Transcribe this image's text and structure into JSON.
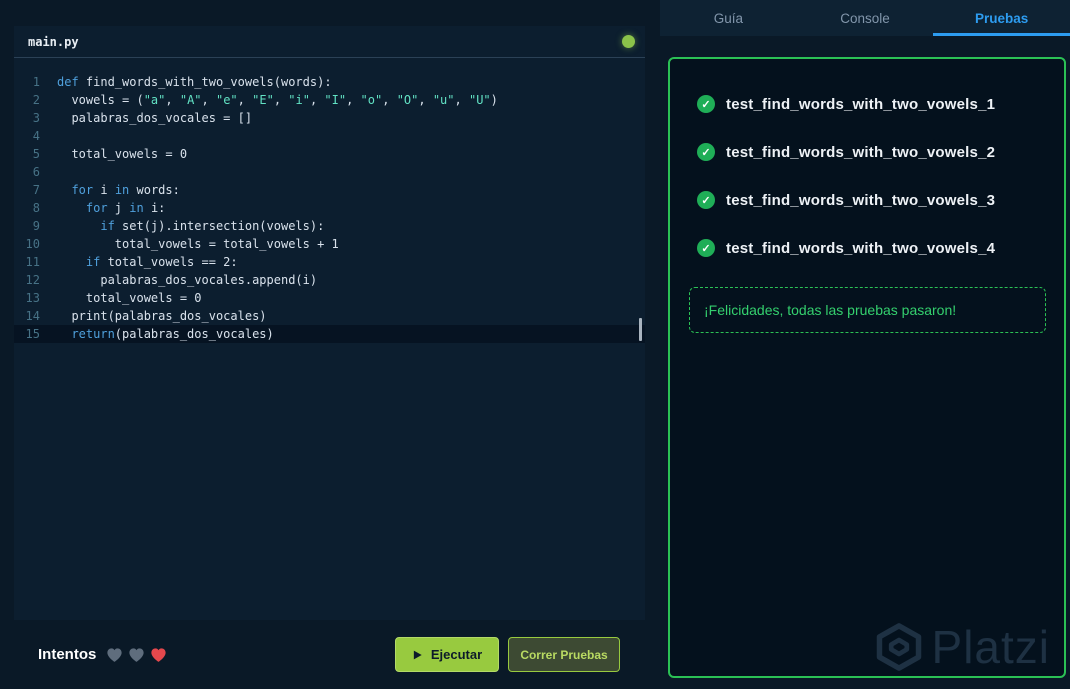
{
  "editor": {
    "filename": "main.py",
    "active_line": 15,
    "lines": [
      {
        "n": 1,
        "tokens": [
          {
            "c": "k",
            "t": "def"
          },
          {
            "c": "d",
            "t": " find_words_with_two_vowels(words):"
          }
        ]
      },
      {
        "n": 2,
        "tokens": [
          {
            "c": "d",
            "t": "  vowels = ("
          },
          {
            "c": "s",
            "t": "\"a\""
          },
          {
            "c": "d",
            "t": ", "
          },
          {
            "c": "s",
            "t": "\"A\""
          },
          {
            "c": "d",
            "t": ", "
          },
          {
            "c": "s",
            "t": "\"e\""
          },
          {
            "c": "d",
            "t": ", "
          },
          {
            "c": "s",
            "t": "\"E\""
          },
          {
            "c": "d",
            "t": ", "
          },
          {
            "c": "s",
            "t": "\"i\""
          },
          {
            "c": "d",
            "t": ", "
          },
          {
            "c": "s",
            "t": "\"I\""
          },
          {
            "c": "d",
            "t": ", "
          },
          {
            "c": "s",
            "t": "\"o\""
          },
          {
            "c": "d",
            "t": ", "
          },
          {
            "c": "s",
            "t": "\"O\""
          },
          {
            "c": "d",
            "t": ", "
          },
          {
            "c": "s",
            "t": "\"u\""
          },
          {
            "c": "d",
            "t": ", "
          },
          {
            "c": "s",
            "t": "\"U\""
          },
          {
            "c": "d",
            "t": ")"
          }
        ]
      },
      {
        "n": 3,
        "tokens": [
          {
            "c": "d",
            "t": "  palabras_dos_vocales = []"
          }
        ]
      },
      {
        "n": 4,
        "tokens": []
      },
      {
        "n": 5,
        "tokens": [
          {
            "c": "d",
            "t": "  total_vowels = 0"
          }
        ]
      },
      {
        "n": 6,
        "tokens": []
      },
      {
        "n": 7,
        "tokens": [
          {
            "c": "k",
            "t": "  for"
          },
          {
            "c": "d",
            "t": " i "
          },
          {
            "c": "k",
            "t": "in"
          },
          {
            "c": "d",
            "t": " words:"
          }
        ]
      },
      {
        "n": 8,
        "tokens": [
          {
            "c": "k",
            "t": "    for"
          },
          {
            "c": "d",
            "t": " j "
          },
          {
            "c": "k",
            "t": "in"
          },
          {
            "c": "d",
            "t": " i:"
          }
        ]
      },
      {
        "n": 9,
        "tokens": [
          {
            "c": "k",
            "t": "      if"
          },
          {
            "c": "d",
            "t": " set(j).intersection(vowels):"
          }
        ]
      },
      {
        "n": 10,
        "tokens": [
          {
            "c": "d",
            "t": "        total_vowels = total_vowels + 1"
          }
        ]
      },
      {
        "n": 11,
        "tokens": [
          {
            "c": "k",
            "t": "    if"
          },
          {
            "c": "d",
            "t": " total_vowels == 2:"
          }
        ]
      },
      {
        "n": 12,
        "tokens": [
          {
            "c": "d",
            "t": "      palabras_dos_vocales.append(i)"
          }
        ]
      },
      {
        "n": 13,
        "tokens": [
          {
            "c": "d",
            "t": "    total_vowels = 0"
          }
        ]
      },
      {
        "n": 14,
        "tokens": [
          {
            "c": "d",
            "t": "  print(palabras_dos_vocales)"
          }
        ]
      },
      {
        "n": 15,
        "tokens": [
          {
            "c": "k",
            "t": "  return"
          },
          {
            "c": "d",
            "t": "(palabras_dos_vocales)"
          }
        ]
      }
    ]
  },
  "footer": {
    "attempts_label": "Intentos",
    "hearts": [
      "gray",
      "gray",
      "red"
    ],
    "run_label": "Ejecutar",
    "tests_label": "Correr Pruebas"
  },
  "right": {
    "tabs": [
      {
        "label": "Guía",
        "active": false
      },
      {
        "label": "Console",
        "active": false
      },
      {
        "label": "Pruebas",
        "active": true
      }
    ],
    "tests": [
      "test_find_words_with_two_vowels_1",
      "test_find_words_with_two_vowels_2",
      "test_find_words_with_two_vowels_3",
      "test_find_words_with_two_vowels_4"
    ],
    "congrats_message": "¡Felicidades, todas las pruebas pasaron!",
    "watermark": "Platzi"
  },
  "colors": {
    "accent_green": "#2bc155",
    "tab_active_blue": "#2d9cf0",
    "heart_red": "#e5484d",
    "heart_gray": "#5f6d7d",
    "button_green": "#98ca3f",
    "status_dot": "#8bc34a"
  }
}
